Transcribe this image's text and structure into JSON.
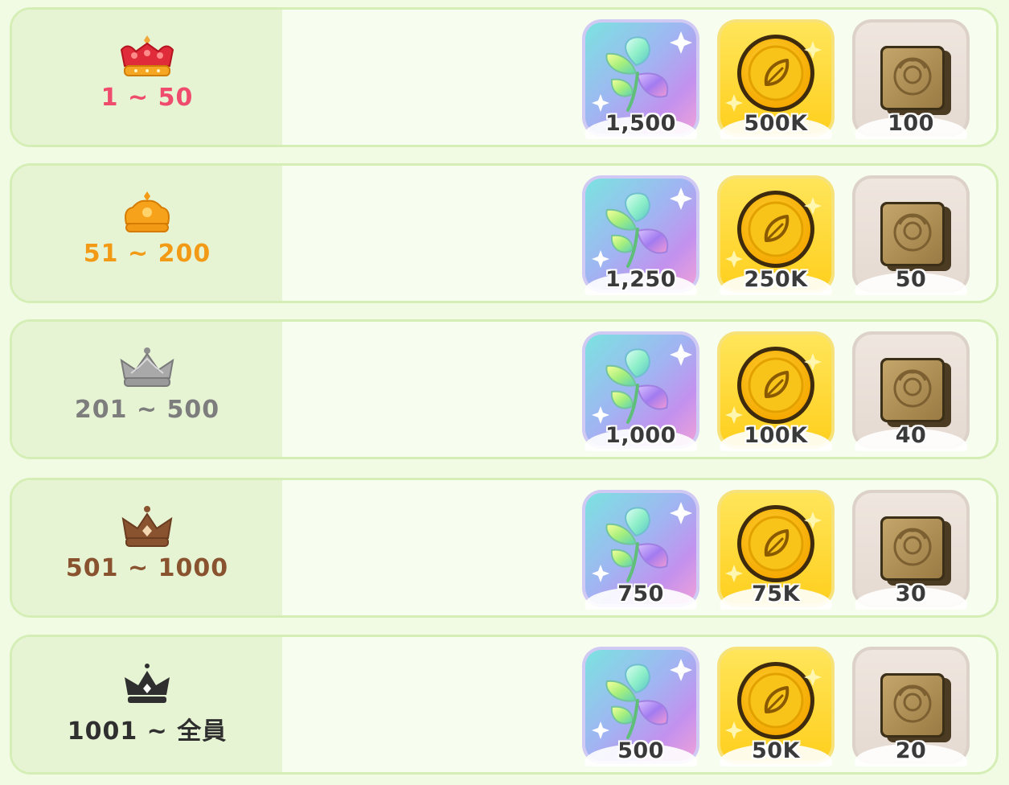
{
  "colors": {
    "background": "#f1fbe4",
    "row_border": "#d5eeb6",
    "rank_panel": "#e6f4d4",
    "tier_red": "#ef4b6c",
    "tier_orange": "#f29a16",
    "tier_silver": "#7d7d7d",
    "tier_bronze": "#8a5330",
    "tier_black": "#2f2f2f"
  },
  "tiers": [
    {
      "range": "1 ~ 50",
      "crown_icon": "red-crown-icon",
      "rewards": [
        {
          "item": "crystal-leaf",
          "icon": "crystal-leaf-icon",
          "amount": "1,500"
        },
        {
          "item": "gold-coin",
          "icon": "gold-coin-icon",
          "amount": "500K"
        },
        {
          "item": "stamp-card",
          "icon": "stamp-card-icon",
          "amount": "100"
        }
      ]
    },
    {
      "range": "51 ~ 200",
      "crown_icon": "orange-crown-icon",
      "rewards": [
        {
          "item": "crystal-leaf",
          "icon": "crystal-leaf-icon",
          "amount": "1,250"
        },
        {
          "item": "gold-coin",
          "icon": "gold-coin-icon",
          "amount": "250K"
        },
        {
          "item": "stamp-card",
          "icon": "stamp-card-icon",
          "amount": "50"
        }
      ]
    },
    {
      "range": "201 ~ 500",
      "crown_icon": "silver-crown-icon",
      "rewards": [
        {
          "item": "crystal-leaf",
          "icon": "crystal-leaf-icon",
          "amount": "1,000"
        },
        {
          "item": "gold-coin",
          "icon": "gold-coin-icon",
          "amount": "100K"
        },
        {
          "item": "stamp-card",
          "icon": "stamp-card-icon",
          "amount": "40"
        }
      ]
    },
    {
      "range": "501 ~ 1000",
      "crown_icon": "bronze-crown-icon",
      "rewards": [
        {
          "item": "crystal-leaf",
          "icon": "crystal-leaf-icon",
          "amount": "750"
        },
        {
          "item": "gold-coin",
          "icon": "gold-coin-icon",
          "amount": "75K"
        },
        {
          "item": "stamp-card",
          "icon": "stamp-card-icon",
          "amount": "30"
        }
      ]
    },
    {
      "range": "1001 ~ 全員",
      "crown_icon": "black-crown-icon",
      "rewards": [
        {
          "item": "crystal-leaf",
          "icon": "crystal-leaf-icon",
          "amount": "500"
        },
        {
          "item": "gold-coin",
          "icon": "gold-coin-icon",
          "amount": "50K"
        },
        {
          "item": "stamp-card",
          "icon": "stamp-card-icon",
          "amount": "20"
        }
      ]
    }
  ]
}
